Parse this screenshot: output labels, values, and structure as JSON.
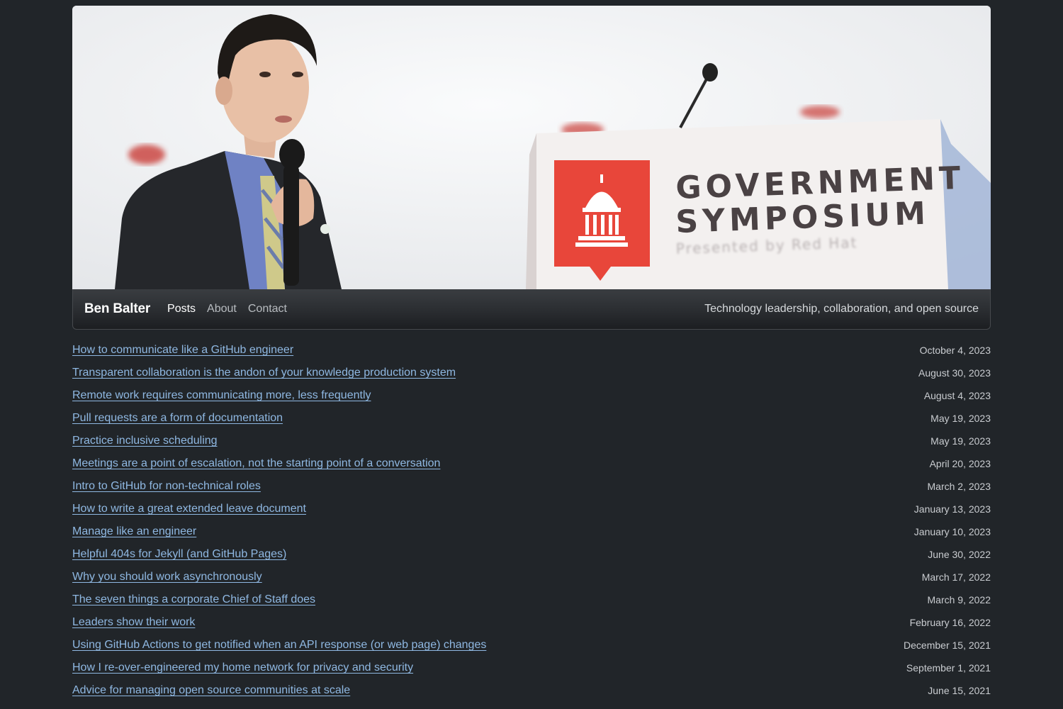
{
  "hero": {
    "image_alt": "Ben Balter speaking at Government Symposium",
    "sign_line1": "GOVERNMENT",
    "sign_line2": "SYMPOSIUM",
    "sign_line3": "Presented by Red Hat"
  },
  "navbar": {
    "brand": "Ben Balter",
    "items": [
      {
        "label": "Posts",
        "active": true
      },
      {
        "label": "About",
        "active": false
      },
      {
        "label": "Contact",
        "active": false
      }
    ],
    "tagline": "Technology leadership, collaboration, and open source"
  },
  "posts": [
    {
      "title": "How to communicate like a GitHub engineer",
      "date": "October 4, 2023"
    },
    {
      "title": "Transparent collaboration is the andon of your knowledge production system",
      "date": "August 30, 2023"
    },
    {
      "title": "Remote work requires communicating more, less frequently",
      "date": "August 4, 2023"
    },
    {
      "title": "Pull requests are a form of documentation",
      "date": "May 19, 2023"
    },
    {
      "title": "Practice inclusive scheduling",
      "date": "May 19, 2023"
    },
    {
      "title": "Meetings are a point of escalation, not the starting point of a conversation",
      "date": "April 20, 2023"
    },
    {
      "title": "Intro to GitHub for non-technical roles",
      "date": "March 2, 2023"
    },
    {
      "title": "How to write a great extended leave document",
      "date": "January 13, 2023"
    },
    {
      "title": "Manage like an engineer",
      "date": "January 10, 2023"
    },
    {
      "title": "Helpful 404s for Jekyll (and GitHub Pages)",
      "date": "June 30, 2022"
    },
    {
      "title": "Why you should work asynchronously",
      "date": "March 17, 2022"
    },
    {
      "title": "The seven things a corporate Chief of Staff does",
      "date": "March 9, 2022"
    },
    {
      "title": "Leaders show their work",
      "date": "February 16, 2022"
    },
    {
      "title": "Using GitHub Actions to get notified when an API response (or web page) changes",
      "date": "December 15, 2021"
    },
    {
      "title": "How I re-over-engineered my home network for privacy and security",
      "date": "September 1, 2021"
    },
    {
      "title": "Advice for managing open source communities at scale",
      "date": "June 15, 2021"
    }
  ],
  "colors": {
    "background": "#212529",
    "link": "#8fb8e2",
    "sign_red": "#e8463a"
  }
}
